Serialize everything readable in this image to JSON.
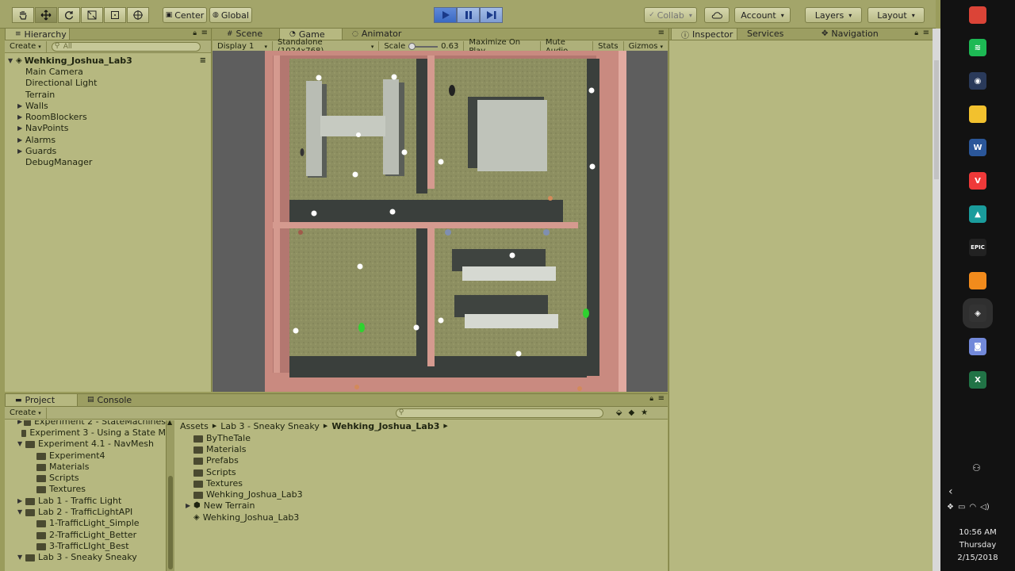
{
  "toolbar": {
    "center_label": "Center",
    "global_label": "Global",
    "collab_label": "Collab",
    "account_label": "Account",
    "layers_label": "Layers",
    "layout_label": "Layout"
  },
  "hierarchy": {
    "tab_label": "Hierarchy",
    "create_label": "Create",
    "search_placeholder": "All",
    "scene_name": "Wehking_Joshua_Lab3",
    "items": [
      {
        "label": "Main Camera",
        "expandable": false
      },
      {
        "label": "Directional Light",
        "expandable": false
      },
      {
        "label": "Terrain",
        "expandable": false
      },
      {
        "label": "Walls",
        "expandable": true
      },
      {
        "label": "RoomBlockers",
        "expandable": true
      },
      {
        "label": "NavPoints",
        "expandable": true
      },
      {
        "label": "Alarms",
        "expandable": true
      },
      {
        "label": "Guards",
        "expandable": true
      },
      {
        "label": "DebugManager",
        "expandable": false
      }
    ]
  },
  "center_tabs": [
    {
      "label": "Scene",
      "icon": "hash-icon"
    },
    {
      "label": "Game",
      "icon": "pacman-icon"
    },
    {
      "label": "Animator",
      "icon": "animator-icon"
    }
  ],
  "game_bar": {
    "display": "Display 1",
    "resolution": "Standalone (1024x768)",
    "scale_label": "Scale",
    "scale_value": "0.63",
    "maximize": "Maximize On Play",
    "mute": "Mute Audio",
    "stats": "Stats",
    "gizmos": "Gizmos"
  },
  "right_tabs": [
    {
      "label": "Inspector",
      "icon": "info-icon"
    },
    {
      "label": "Services",
      "icon": ""
    },
    {
      "label": "Navigation",
      "icon": "nav-icon"
    }
  ],
  "bottom_tabs": [
    {
      "label": "Project",
      "icon": "folder-icon"
    },
    {
      "label": "Console",
      "icon": "console-icon"
    }
  ],
  "project": {
    "create_label": "Create",
    "breadcrumb": [
      "Assets",
      "Lab 3 - Sneaky Sneaky",
      "Wehking_Joshua_Lab3"
    ],
    "tree": [
      {
        "label": "Experiment 2 - StateMachines",
        "indent": 1,
        "tri": "▶"
      },
      {
        "label": "Experiment 3 - Using a State M",
        "indent": 1,
        "tri": ""
      },
      {
        "label": "Experiment 4.1 - NavMesh",
        "indent": 1,
        "tri": "▼"
      },
      {
        "label": "Experiment4",
        "indent": 2,
        "tri": ""
      },
      {
        "label": "Materials",
        "indent": 2,
        "tri": ""
      },
      {
        "label": "Scripts",
        "indent": 2,
        "tri": ""
      },
      {
        "label": "Textures",
        "indent": 2,
        "tri": ""
      },
      {
        "label": "Lab 1 - Traffic Light",
        "indent": 1,
        "tri": "▶"
      },
      {
        "label": "Lab 2 - TrafficLightAPI",
        "indent": 1,
        "tri": "▼"
      },
      {
        "label": "1-TrafficLight_Simple",
        "indent": 2,
        "tri": ""
      },
      {
        "label": "2-TrafficLight_Better",
        "indent": 2,
        "tri": ""
      },
      {
        "label": "3-TrafficLIght_Best",
        "indent": 2,
        "tri": ""
      },
      {
        "label": "Lab 3 - Sneaky Sneaky",
        "indent": 1,
        "tri": "▼"
      }
    ],
    "files": [
      {
        "label": "ByTheTale",
        "type": "folder",
        "tri": ""
      },
      {
        "label": "Materials",
        "type": "folder",
        "tri": ""
      },
      {
        "label": "Prefabs",
        "type": "folder",
        "tri": ""
      },
      {
        "label": "Scripts",
        "type": "folder",
        "tri": ""
      },
      {
        "label": "Textures",
        "type": "folder",
        "tri": ""
      },
      {
        "label": "Wehking_Joshua_Lab3",
        "type": "folder",
        "tri": ""
      },
      {
        "label": "New Terrain",
        "type": "terrain",
        "tri": "▶"
      },
      {
        "label": "Wehking_Joshua_Lab3",
        "type": "scene",
        "tri": ""
      }
    ]
  },
  "taskbar": {
    "time": "10:56 AM",
    "day": "Thursday",
    "date": "2/15/2018",
    "icons": [
      {
        "name": "chrome-icon",
        "color": "#db4437",
        "glyph": ""
      },
      {
        "name": "spotify-icon",
        "color": "#1db954",
        "glyph": "≋"
      },
      {
        "name": "media-icon",
        "color": "#2a3a5a",
        "glyph": "◉"
      },
      {
        "name": "file-explorer-icon",
        "color": "#f2c12e",
        "glyph": ""
      },
      {
        "name": "word-icon",
        "color": "#2b579a",
        "glyph": "W"
      },
      {
        "name": "vivaldi-icon",
        "color": "#ef3939",
        "glyph": "V"
      },
      {
        "name": "unity-hub-icon",
        "color": "#1a9c9c",
        "glyph": "▲"
      },
      {
        "name": "epic-games-icon",
        "color": "#222",
        "glyph": "EPIC"
      },
      {
        "name": "usb-drive-icon",
        "color": "#f28b1c",
        "glyph": ""
      },
      {
        "name": "unity-icon",
        "color": "#333",
        "glyph": "◈"
      },
      {
        "name": "discord-icon",
        "color": "#7289da",
        "glyph": "◙"
      },
      {
        "name": "excel-icon",
        "color": "#217346",
        "glyph": "X"
      }
    ]
  }
}
